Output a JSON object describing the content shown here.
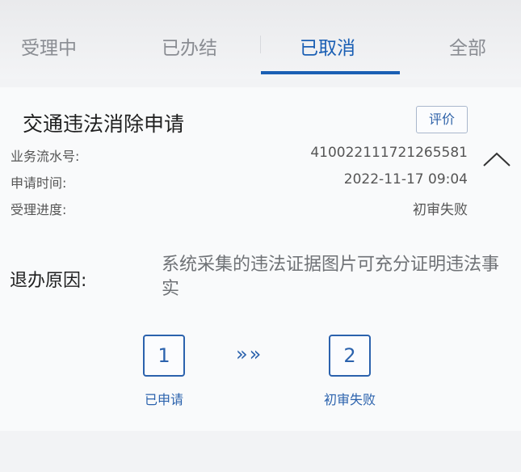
{
  "tabs": [
    {
      "label": "受理中"
    },
    {
      "label": "已办结"
    },
    {
      "label": "已取消"
    },
    {
      "label": "全部"
    }
  ],
  "active_tab": "已取消",
  "card": {
    "title": "交通违法消除申请",
    "rate_button": "评价",
    "fields": [
      {
        "label": "业务流水号:",
        "value": "410022111721265581"
      },
      {
        "label": "申请时间:",
        "value": "2022-11-17 09:04"
      },
      {
        "label": "受理进度:",
        "value": "初审失败"
      }
    ],
    "reason_label": "退办原因:",
    "reason_text": "系统采集的违法证据图片可充分证明违法事实",
    "steps": [
      {
        "number": "1",
        "label": "已申请"
      },
      {
        "number": "2",
        "label": "初审失败"
      }
    ],
    "step_arrows": "»»"
  },
  "colors": {
    "accent": "#1a5fb4",
    "tab_inactive": "#8a8d93",
    "background": "#f2f3f5"
  },
  "icons": {
    "collapse": "chevron-up-icon",
    "step_arrows": "double-chevron-right-icon"
  }
}
